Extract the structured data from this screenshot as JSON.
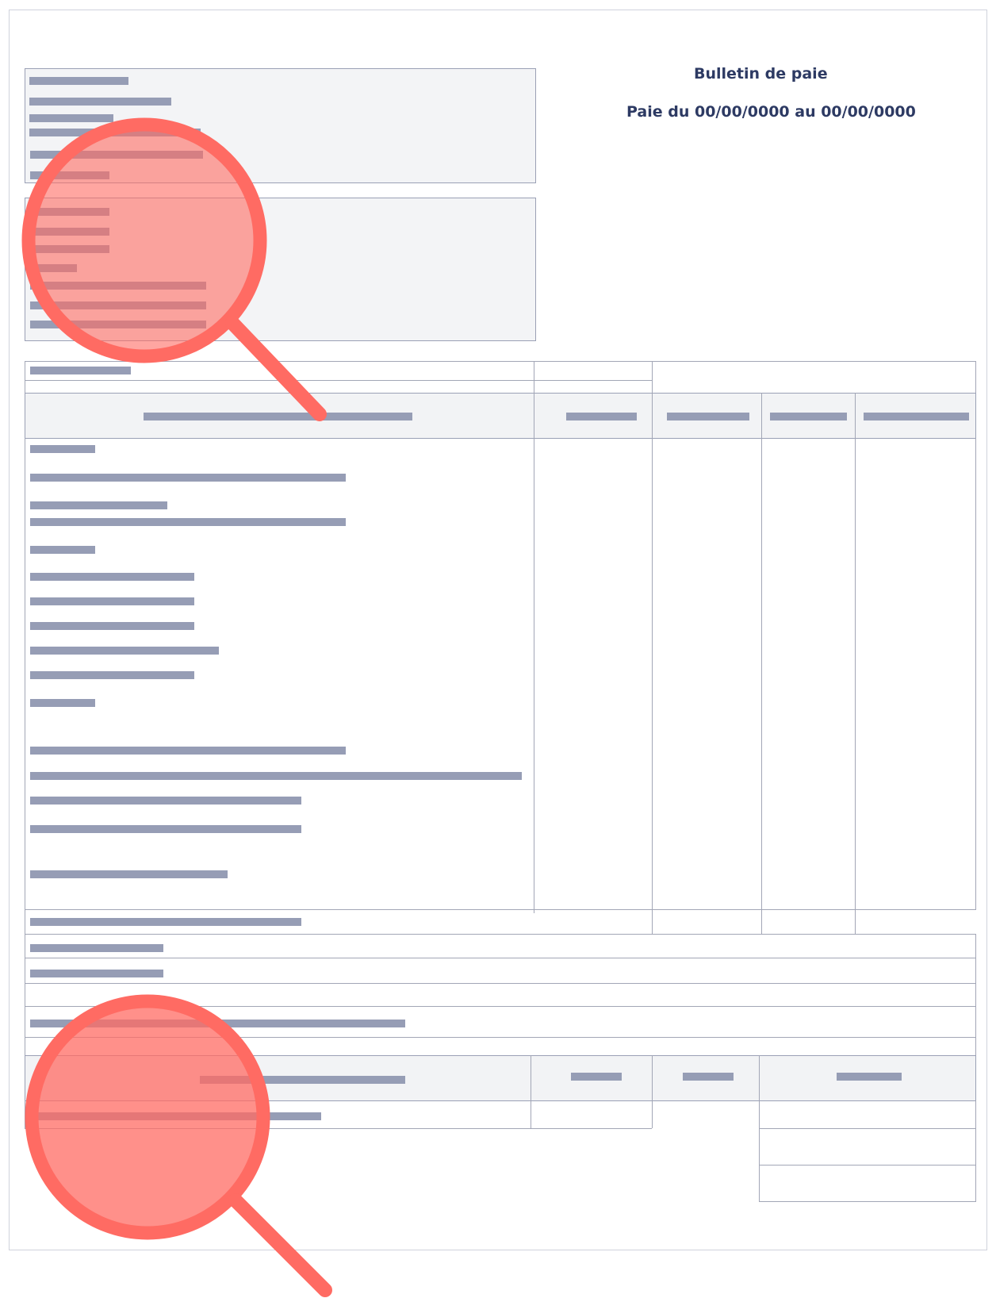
{
  "document": {
    "title": "Bulletin de paie",
    "period": "Paie du 00/00/0000 au 00/00/0000"
  },
  "overlay": {
    "magnifier_color": "#ff6b63",
    "magnifier_icon": "magnifier-icon"
  },
  "colors": {
    "placeholder_bar": "#969db5",
    "border": "#9aa0b5",
    "header_fill": "#f2f3f5",
    "title_text": "#2d3a63"
  }
}
